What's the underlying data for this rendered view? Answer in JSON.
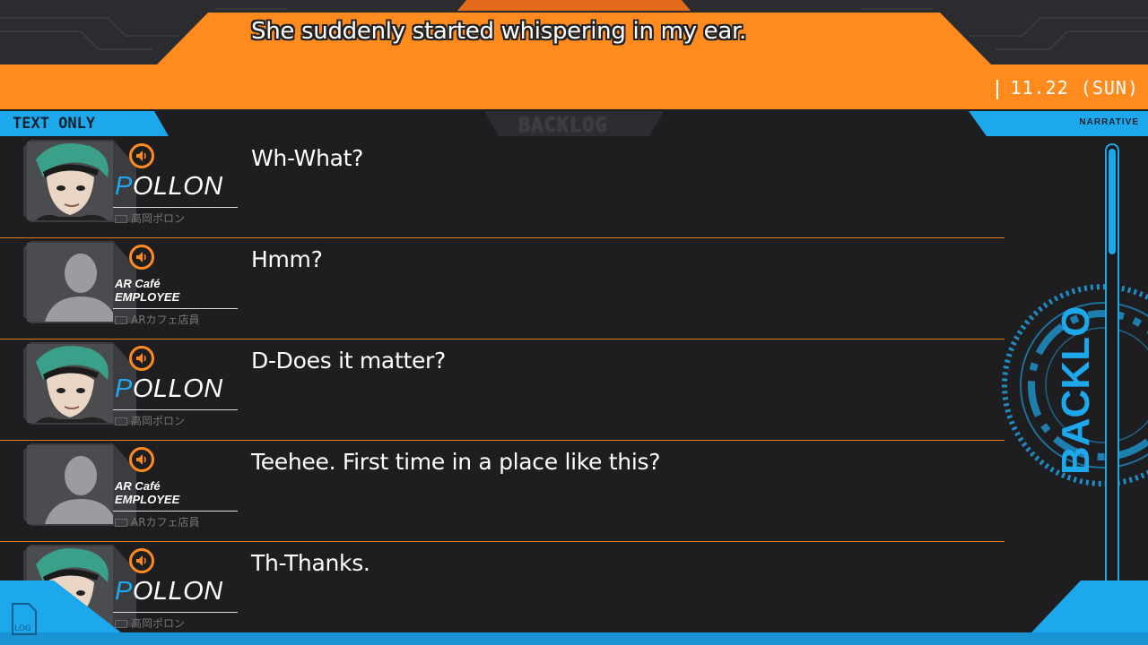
{
  "top": {
    "dialog_line": "She suddenly started whispering in my ear.",
    "date": "11.22 (SUN)"
  },
  "header": {
    "text_only": "TEXT ONLY",
    "title": "BACKLOG",
    "narrative": "NARRATIVE"
  },
  "entries": [
    {
      "speaker_first": "P",
      "speaker_rest": "OLLON",
      "speaker_jp": "高岡ポロン",
      "text": "Wh-What?",
      "portrait": "pollon"
    },
    {
      "speaker_line1": "AR Café",
      "speaker_line2": "EMPLOYEE",
      "speaker_jp": "ARカフェ店員",
      "text": "Hmm?",
      "portrait": "silhouette"
    },
    {
      "speaker_first": "P",
      "speaker_rest": "OLLON",
      "speaker_jp": "高岡ポロン",
      "text": "D-Does it matter?",
      "portrait": "pollon"
    },
    {
      "speaker_line1": "AR Café",
      "speaker_line2": "EMPLOYEE",
      "speaker_jp": "ARカフェ店員",
      "text": "Teehee. First time in a place like this?",
      "portrait": "silhouette"
    },
    {
      "speaker_first": "P",
      "speaker_rest": "OLLON",
      "speaker_jp": "高岡ポロン",
      "text": "Th-Thanks.",
      "portrait": "pollon"
    }
  ],
  "side": {
    "backlog_label": "BACKLOG"
  },
  "bottom": {
    "log_icon_label": "LOG"
  },
  "colors": {
    "orange": "#ff8a1e",
    "blue": "#1ea8ec",
    "background": "#1e1e20"
  }
}
